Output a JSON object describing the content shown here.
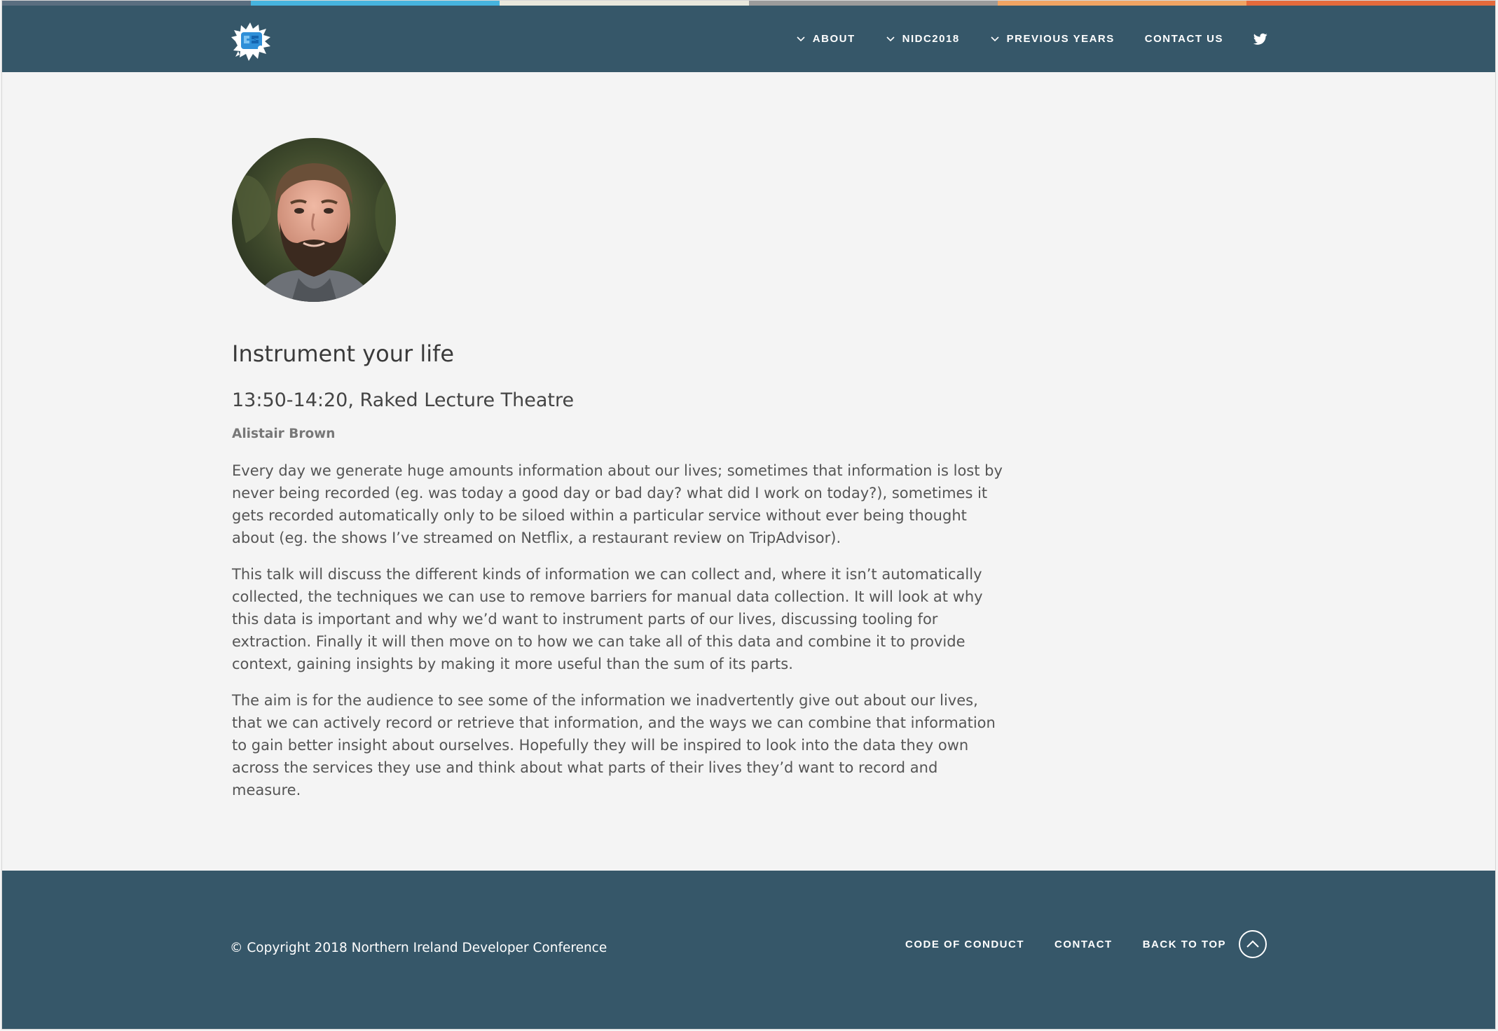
{
  "stripe_colors": [
    "#5a6e80",
    "#46b4df",
    "#e9e7dc",
    "#9b9b9b",
    "#f0a463",
    "#e46a3c"
  ],
  "header": {
    "logo_icon": "nidc-logo-icon",
    "nav": [
      {
        "label": "ABOUT",
        "has_dropdown": true
      },
      {
        "label": "NIDC2018",
        "has_dropdown": true
      },
      {
        "label": "PREVIOUS YEARS",
        "has_dropdown": true
      },
      {
        "label": "CONTACT US",
        "has_dropdown": false
      }
    ],
    "social_icon": "twitter-icon"
  },
  "talk": {
    "title": "Instrument your life",
    "time_location": "13:50-14:20, Raked Lecture Theatre",
    "speaker": "Alistair Brown",
    "paragraphs": [
      "Every day we generate huge amounts information about our lives; sometimes that information is lost by never being recorded (eg. was today a good day or bad day? what did I work on today?), sometimes it gets recorded automatically only to be siloed within a particular service without ever being thought about (eg. the shows I’ve streamed on Netflix, a restaurant review on TripAdvisor).",
      "This talk will discuss the different kinds of information we can collect and, where it isn’t automatically collected, the techniques we can use to remove barriers for manual data collection. It will look at why this data is important and why we’d want to instrument parts of our lives, discussing tooling for extraction. Finally it will then move on to how we can take all of this data and combine it to provide context, gaining insights by making it more useful than the sum of its parts.",
      "The aim is for the audience to see some of the information we inadvertently give out about our lives, that we can actively record or retrieve that information, and the ways we can combine that information to gain better insight about ourselves. Hopefully they will be inspired to look into the data they own across the services they use and think about what parts of their lives they’d want to record and measure."
    ]
  },
  "footer": {
    "copyright": "© Copyright 2018 Northern Ireland Developer Conference",
    "code_of_conduct": "CODE OF CONDUCT",
    "contact": "CONTACT",
    "back_to_top": "BACK TO TOP",
    "back_to_top_icon": "chevron-up-icon"
  },
  "colors": {
    "header_bg": "#365769",
    "page_bg": "#f4f4f4"
  }
}
